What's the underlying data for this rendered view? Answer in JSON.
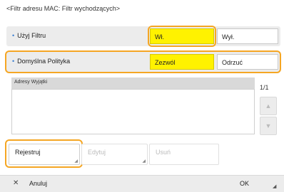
{
  "title": "<Filtr adresu MAC: Filtr wychodzących>",
  "rows": [
    {
      "label": "Użyj Filtru",
      "options": [
        "Wł.",
        "Wył."
      ],
      "selected": 0
    },
    {
      "label": "Domyślna Polityka",
      "options": [
        "Zezwól",
        "Odrzuć"
      ],
      "selected": 0
    }
  ],
  "list": {
    "header": "Adresy Wyjątki",
    "page_indicator": "1/1",
    "items": []
  },
  "actions": {
    "register": "Rejestruj",
    "edit": "Edytuj",
    "delete": "Usuń"
  },
  "footer": {
    "cancel": "Anuluj",
    "ok": "OK"
  },
  "colors": {
    "selected": "#fff200",
    "highlight": "#f5a623",
    "bullet": "#3b7fd1"
  }
}
